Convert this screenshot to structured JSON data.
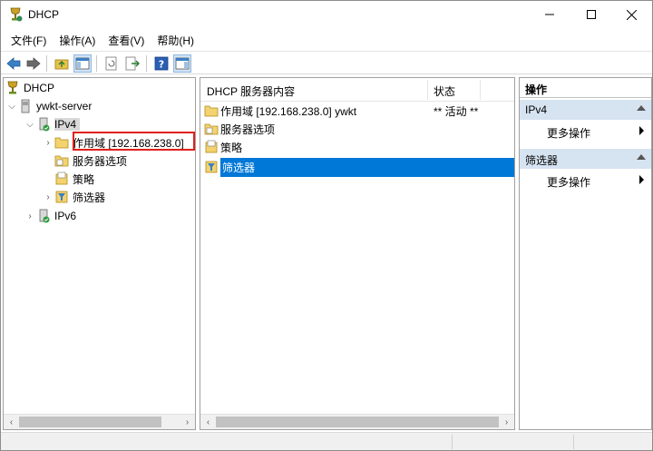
{
  "window": {
    "title": "DHCP"
  },
  "menu": [
    "文件(F)",
    "操作(A)",
    "查看(V)",
    "帮助(H)"
  ],
  "tree": {
    "root": "DHCP",
    "server": "ywkt-server",
    "ipv4": "IPv4",
    "scope": "作用域 [192.168.238.0]",
    "server_options": "服务器选项",
    "policies": "策略",
    "filters": "筛选器",
    "ipv6": "IPv6"
  },
  "list": {
    "col_name": "DHCP 服务器内容",
    "col_status": "状态",
    "rows": [
      {
        "name": "作用域 [192.168.238.0] ywkt",
        "status": "** 活动 **"
      },
      {
        "name": "服务器选项",
        "status": ""
      },
      {
        "name": "策略",
        "status": ""
      },
      {
        "name": "筛选器",
        "status": ""
      }
    ]
  },
  "actions": {
    "title": "操作",
    "group1": "IPv4",
    "group1_more": "更多操作",
    "group2": "筛选器",
    "group2_more": "更多操作"
  },
  "colors": {
    "selection": "#0078d7",
    "action_group": "#d6e3f1",
    "highlight_box": "#e0201b"
  }
}
